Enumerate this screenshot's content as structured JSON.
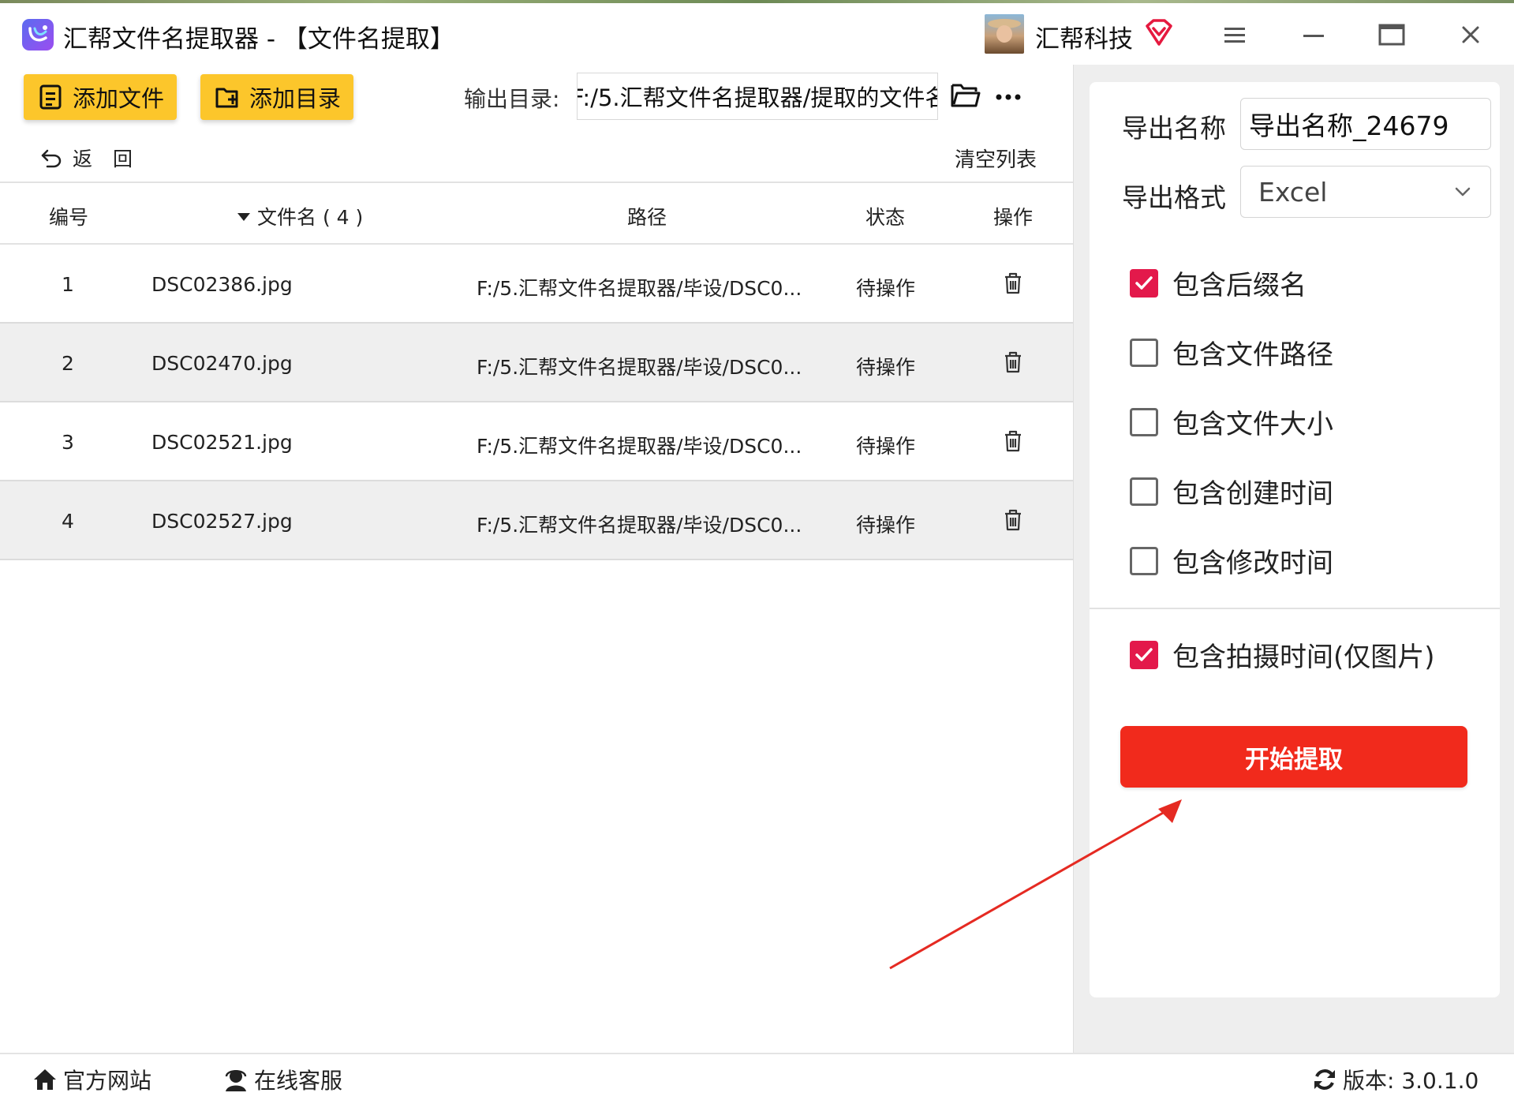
{
  "titlebar": {
    "app_title": "汇帮文件名提取器 - 【文件名提取】",
    "company_name": "汇帮科技"
  },
  "toolbar": {
    "add_file_label": "添加文件",
    "add_folder_label": "添加目录",
    "output_dir_label": "输出目录:",
    "output_dir_value": "F:/5.汇帮文件名提取器/提取的文件名",
    "back_label": "返回",
    "clear_list_label": "清空列表"
  },
  "table": {
    "headers": {
      "index": "编号",
      "filename": "文件名 ( 4 )",
      "path": "路径",
      "status": "状态",
      "action": "操作"
    },
    "rows": [
      {
        "index": "1",
        "filename": "DSC02386.jpg",
        "path": "F:/5.汇帮文件名提取器/毕设/DSC0...",
        "status": "待操作"
      },
      {
        "index": "2",
        "filename": "DSC02470.jpg",
        "path": "F:/5.汇帮文件名提取器/毕设/DSC0...",
        "status": "待操作"
      },
      {
        "index": "3",
        "filename": "DSC02521.jpg",
        "path": "F:/5.汇帮文件名提取器/毕设/DSC0...",
        "status": "待操作"
      },
      {
        "index": "4",
        "filename": "DSC02527.jpg",
        "path": "F:/5.汇帮文件名提取器/毕设/DSC0...",
        "status": "待操作"
      }
    ]
  },
  "settings": {
    "export_name_label": "导出名称",
    "export_name_value": "导出名称_24679",
    "export_format_label": "导出格式",
    "export_format_value": "Excel",
    "options": [
      {
        "label": "包含后缀名",
        "checked": true
      },
      {
        "label": "包含文件路径",
        "checked": false
      },
      {
        "label": "包含文件大小",
        "checked": false
      },
      {
        "label": "包含创建时间",
        "checked": false
      },
      {
        "label": "包含修改时间",
        "checked": false
      }
    ],
    "photo_time_option": {
      "label": "包含拍摄时间(仅图片)",
      "checked": true
    },
    "start_label": "开始提取"
  },
  "footer": {
    "website_label": "官方网站",
    "support_label": "在线客服",
    "version_label": "版本: 3.0.1.0"
  },
  "colors": {
    "accent_yellow": "#fcc62b",
    "start_red": "#f12a1c",
    "check_red": "#e3194b"
  },
  "icons": {
    "app": "app-logo-icon",
    "vip": "vip-diamond-icon",
    "menu": "menu-icon",
    "minimize": "minimize-icon",
    "maximize": "maximize-icon",
    "close": "close-icon",
    "add_file": "add-file-icon",
    "add_folder": "add-folder-icon",
    "folder": "folder-icon",
    "more": "more-icon",
    "back": "back-arrow-icon",
    "sort": "sort-down-icon",
    "trash": "trash-icon",
    "dropdown": "chevron-down-icon",
    "home": "home-icon",
    "support": "support-icon",
    "refresh": "refresh-icon"
  }
}
